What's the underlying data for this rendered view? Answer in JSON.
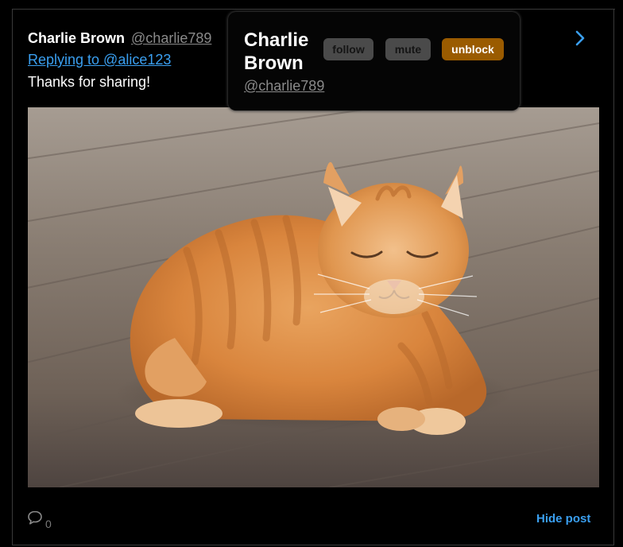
{
  "post": {
    "author_name": "Charlie Brown",
    "author_handle": "@charlie789",
    "reply_text": "Replying to @alice123",
    "body_text": "Thanks for sharing!",
    "image_icon": "orange-tabby-cat-photo",
    "comment_icon": "comment-bubble-icon",
    "comment_count": "0",
    "hide_label": "Hide post",
    "next_icon": "chevron-right-icon"
  },
  "popover": {
    "name": "Charlie Brown",
    "handle": "@charlie789",
    "buttons": {
      "follow": "follow",
      "mute": "mute",
      "unblock": "unblock"
    }
  },
  "colors": {
    "link": "#3a9ff0",
    "unblock_bg": "#9a5b00",
    "muted_button_bg": "#4a4a4a"
  }
}
